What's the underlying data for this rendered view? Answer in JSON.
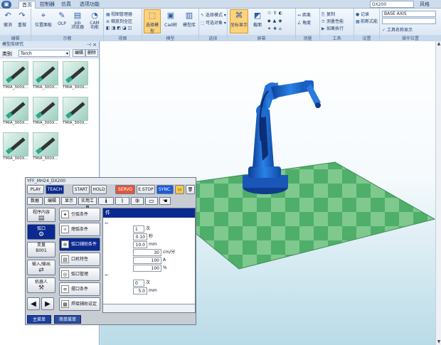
{
  "ribbon_tabs": {
    "app_icon": "▣",
    "tabs": [
      "首页",
      "控制器",
      "仿真",
      "选项功能"
    ],
    "right_combo": "DX200",
    "style_label": "风格"
  },
  "ribbon": {
    "groups": [
      {
        "label": "编辑"
      },
      {
        "label": "示教"
      },
      {
        "label": "视图"
      },
      {
        "label": "模型"
      },
      {
        "label": "选择"
      },
      {
        "label": "屏幕"
      },
      {
        "label": "测量"
      },
      {
        "label": "工具"
      },
      {
        "label": "设置"
      },
      {
        "label": "操作位置"
      }
    ],
    "undo_label": "撤消",
    "redo_label": "重做",
    "pos_mgr_label": "位置面板",
    "olp_label": "OLP",
    "job_label": "Job\n浏览器",
    "cam_label": "CAM\n功能",
    "view_mgr": "视图管理器",
    "zoom_all": "缩放到全区",
    "sel_model_label": "选择模型",
    "cad_tree_label": "Cad树",
    "model_lib_label": "模型库",
    "sel_mode": "选择模式 ▾",
    "sel_obj": "可选对象 ▾",
    "coord_label": "坐标显示",
    "view_label": "截面",
    "distance": "距离",
    "angle": "角度",
    "copy": "复制",
    "measure": "测量性能",
    "record": "记录",
    "shortcut_exec": "如果执行",
    "arrange_label": "前断式能",
    "base_axis": "BASE AXIS",
    "tool_name": "工具名称显示",
    "small_box_blank": ""
  },
  "panel": {
    "title": "模型库研究",
    "category_label": "类别",
    "category_value": "Torch",
    "edit_btn": "编辑",
    "delete_btn": "删除",
    "thumbs": [
      "TMIA_300X...",
      "TMIA_300X...",
      "TMIA_300X...",
      "TMIA_300X...",
      "TMIA_300X...",
      "TMIA_300X...",
      "TMIA_300X...",
      "TMIA_300X..."
    ]
  },
  "pendant": {
    "title": "YFF_MH24_DX200",
    "play": "PLAY",
    "teach": "TEACH",
    "start": "START",
    "hold": "HOLD",
    "servo_on": "SERVO ON",
    "estop": "E.STOP",
    "sync": "SYNC.",
    "tabs": [
      "数据",
      "编辑",
      "显示",
      "实用工具"
    ],
    "left_buttons": [
      {
        "label": "程序内容",
        "icon": "▤"
      },
      {
        "label": "弧口",
        "icon": "⚙"
      },
      {
        "label": "变量\nB001",
        "icon": ""
      },
      {
        "label": "输入/输出",
        "icon": "⇄"
      },
      {
        "label": "机器人",
        "icon": "⚒"
      }
    ],
    "mid_buttons": [
      {
        "label": "引弧条件",
        "icon": "✦"
      },
      {
        "label": "熄弧条件",
        "icon": "✧"
      },
      {
        "label": "弧口辅助条件",
        "icon": "⊕"
      },
      {
        "label": "口机特性",
        "icon": "▧"
      },
      {
        "label": "弧口管理",
        "icon": "◎"
      },
      {
        "label": "摆口条件",
        "icon": "≋"
      },
      {
        "label": "焊接辅助设定",
        "icon": "▦"
      }
    ],
    "main_header": "件",
    "values": [
      {
        "v": "1",
        "u": "次"
      },
      {
        "v": "0.10",
        "u": "秒"
      },
      {
        "v": "10.0",
        "u": "mm"
      },
      {
        "v": "30",
        "u": "cm/分"
      },
      {
        "v": "100",
        "u": "A"
      },
      {
        "v": "100",
        "u": "%"
      },
      {
        "v": "0",
        "u": "次"
      },
      {
        "v": "5.0",
        "u": "mm"
      }
    ],
    "main_menu": "主菜单",
    "simple_menu": "简单菜单"
  },
  "colors": {
    "ribbon_bg": "#dbe6f3",
    "teach": "#0b2a8f",
    "servo": "#e2553b",
    "floor_dark": "#3f9f5f",
    "floor_light": "#7fc98e",
    "robot": "#1e63c8"
  }
}
